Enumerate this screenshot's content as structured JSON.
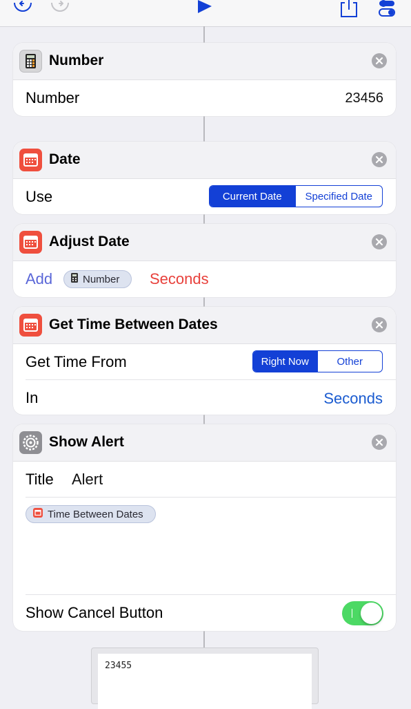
{
  "toolbar": {
    "undo_icon": "undo-icon",
    "redo_icon": "redo-icon",
    "run_icon": "play-icon",
    "share_icon": "share-icon",
    "settings_icon": "toggles-icon",
    "accent": "#1340d6"
  },
  "actions": {
    "number": {
      "title": "Number",
      "icon": "calculator-icon",
      "field_label": "Number",
      "value": "23456"
    },
    "date": {
      "title": "Date",
      "icon": "calendar-icon",
      "field_label": "Use",
      "options": [
        "Current Date",
        "Specified Date"
      ],
      "selected": "Current Date"
    },
    "adjust_date": {
      "title": "Adjust Date",
      "icon": "calendar-icon",
      "operation": "Add",
      "magic_variable": "Number",
      "unit": "Seconds"
    },
    "time_between": {
      "title": "Get Time Between Dates",
      "icon": "calendar-icon",
      "from_label": "Get Time From",
      "from_options": [
        "Right Now",
        "Other"
      ],
      "from_selected": "Right Now",
      "in_label": "In",
      "in_value": "Seconds"
    },
    "show_alert": {
      "title": "Show Alert",
      "icon": "gear-icon",
      "title_label": "Title",
      "title_value": "Alert",
      "message_variable": "Time Between Dates",
      "cancel_label": "Show Cancel Button",
      "cancel_enabled": true
    }
  },
  "result": {
    "text": "23455"
  },
  "colors": {
    "calendar_red": "#ef4f3e",
    "variable_red": "#e8413c",
    "toggle_green": "#4cd964"
  }
}
